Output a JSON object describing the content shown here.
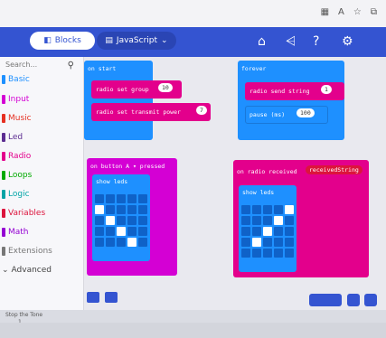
{
  "browser": {
    "icons": [
      "grid-icon",
      "read-aloud-icon",
      "favorite-icon",
      "collections-icon"
    ]
  },
  "header": {
    "tabs": [
      {
        "label": "Blocks",
        "icon": "blocks-icon",
        "active": true
      },
      {
        "label": "JavaScript",
        "icon": "code-icon",
        "active": false
      }
    ],
    "icons": [
      "home-icon",
      "share-icon",
      "help-icon",
      "gear-icon"
    ],
    "brand_color": "#3454d1"
  },
  "sidebar": {
    "search_placeholder": "Search...",
    "categories": [
      {
        "label": "Basic",
        "color": "#1e90ff"
      },
      {
        "label": "Input",
        "color": "#d400d4"
      },
      {
        "label": "Music",
        "color": "#e63022"
      },
      {
        "label": "Led",
        "color": "#5c2d91"
      },
      {
        "label": "Radio",
        "color": "#e3008c"
      },
      {
        "label": "Loops",
        "color": "#00aa00"
      },
      {
        "label": "Logic",
        "color": "#00a4a6"
      },
      {
        "label": "Variables",
        "color": "#dc143c"
      },
      {
        "label": "Math",
        "color": "#9400d3"
      },
      {
        "label": "Extensions",
        "color": "#777777"
      },
      {
        "label": "Advanced",
        "color": "#444444"
      }
    ],
    "download_label": "Stop the Tone",
    "download_value": "1"
  },
  "workspace": {
    "on_start": {
      "title": "on start",
      "blocks": [
        {
          "text": "radio set group",
          "value": "10"
        },
        {
          "text": "radio set transmit power",
          "value": "7"
        }
      ]
    },
    "forever": {
      "title": "forever",
      "send_text": "radio send string",
      "send_value": "1",
      "pause_text": "pause (ms)",
      "pause_value": "100"
    },
    "on_button": {
      "title": "on button  A ▾  pressed",
      "show_leds": "show leds",
      "leds": [
        0,
        0,
        0,
        0,
        0,
        1,
        0,
        0,
        0,
        0,
        0,
        1,
        0,
        0,
        0,
        0,
        0,
        1,
        0,
        0,
        0,
        0,
        0,
        1,
        0
      ]
    },
    "on_radio": {
      "title": "on radio received",
      "param": "receivedString",
      "show_leds": "show leds",
      "leds": [
        0,
        0,
        0,
        0,
        1,
        0,
        0,
        0,
        1,
        0,
        0,
        0,
        1,
        0,
        0,
        0,
        1,
        0,
        0,
        0,
        0,
        0,
        0,
        0,
        0
      ]
    }
  }
}
